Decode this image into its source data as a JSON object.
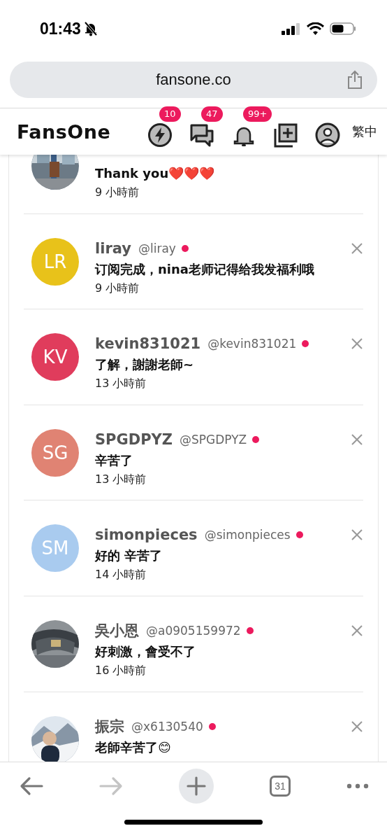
{
  "status_bar": {
    "time": "01:43"
  },
  "browser": {
    "url": "fansone.co",
    "tab_count": "31",
    "forward_disabled": true
  },
  "header": {
    "logo": "FansOne",
    "language": "繁中",
    "icons": [
      {
        "kind": "flash",
        "badge": "10"
      },
      {
        "kind": "chat",
        "badge": "47"
      },
      {
        "kind": "bell",
        "badge": "99+"
      },
      {
        "kind": "add"
      },
      {
        "kind": "profile"
      }
    ]
  },
  "notifications": [
    {
      "message": "Thank you❤️❤️❤️",
      "time": "9 小時前"
    },
    {
      "name": "liray",
      "handle": "@liray",
      "unread": true,
      "message": "订阅完成，nina老师记得给我发福利哦",
      "time": "9 小時前",
      "avatar": {
        "kind": "initials",
        "initials": "LR",
        "color": "#e8c21a"
      }
    },
    {
      "name": "kevin831021",
      "handle": "@kevin831021",
      "unread": true,
      "message": "了解，謝謝老師~",
      "time": "13 小時前",
      "avatar": {
        "kind": "initials",
        "initials": "KV",
        "color": "#e03c5c"
      }
    },
    {
      "name": "SPGDPYZ",
      "handle": "@SPGDPYZ",
      "unread": true,
      "message": "辛苦了",
      "time": "13 小時前",
      "avatar": {
        "kind": "initials",
        "initials": "SG",
        "color": "#e08373"
      }
    },
    {
      "name": "simonpieces",
      "handle": "@simonpieces",
      "unread": true,
      "message": "好的 辛苦了",
      "time": "14 小時前",
      "avatar": {
        "kind": "initials",
        "initials": "SM",
        "color": "#a9cbef"
      }
    },
    {
      "name": "吳小恩",
      "handle": "@a0905159972",
      "unread": true,
      "message": "好刺激，會受不了",
      "time": "16 小時前"
    },
    {
      "name": "振宗",
      "handle": "@x6130540",
      "unread": true,
      "message": "老師辛苦了😊"
    }
  ]
}
